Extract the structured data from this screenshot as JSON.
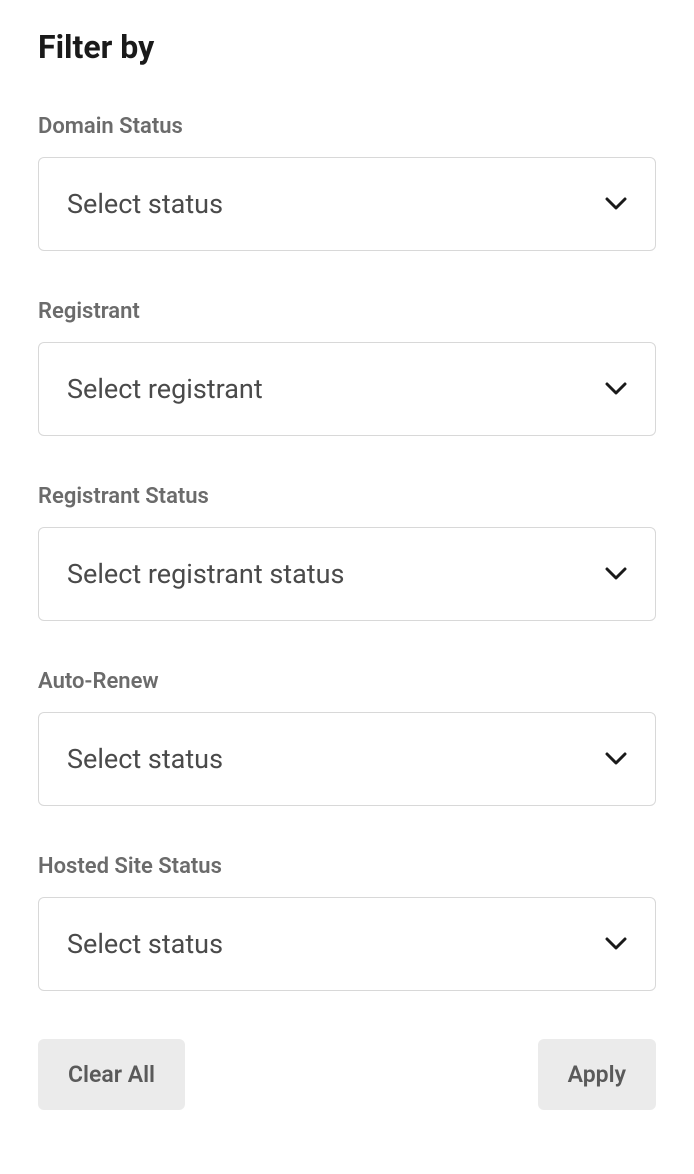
{
  "title": "Filter by",
  "filters": {
    "domainStatus": {
      "label": "Domain Status",
      "value": "Select status"
    },
    "registrant": {
      "label": "Registrant",
      "value": "Select registrant"
    },
    "registrantStatus": {
      "label": "Registrant Status",
      "value": "Select registrant status"
    },
    "autoRenew": {
      "label": "Auto-Renew",
      "value": "Select status"
    },
    "hostedSiteStatus": {
      "label": "Hosted Site Status",
      "value": "Select status"
    }
  },
  "buttons": {
    "clearAll": "Clear All",
    "apply": "Apply"
  }
}
